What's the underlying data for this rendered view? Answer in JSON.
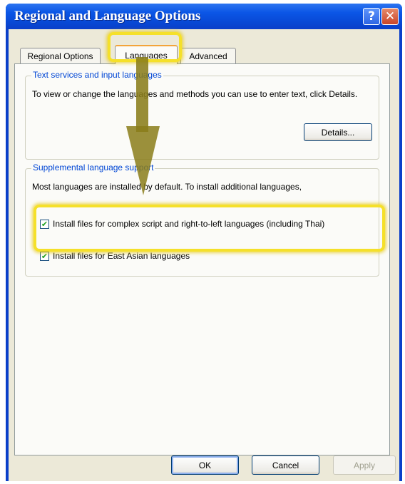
{
  "window": {
    "title": "Regional and Language Options"
  },
  "titlebar_buttons": {
    "help": "?",
    "close": "✕"
  },
  "tabs": [
    {
      "label": "Regional Options"
    },
    {
      "label": "Languages"
    },
    {
      "label": "Advanced"
    }
  ],
  "text_services": {
    "legend": "Text services and input languages",
    "description": "To view or change the languages and methods you can use to enter text, click Details.",
    "details_button": "Details..."
  },
  "supplemental": {
    "legend": "Supplemental language support",
    "description": "Most languages are installed by default. To install additional languages,",
    "checkboxes": [
      {
        "label": "Install files for complex script and right-to-left languages (including Thai)",
        "checked": true
      },
      {
        "label": "Install files for East Asian languages",
        "checked": true
      }
    ]
  },
  "footer": {
    "ok": "OK",
    "cancel": "Cancel",
    "apply": "Apply"
  },
  "colors": {
    "title_blue": "#0a3fc9",
    "legend_blue": "#0046d5",
    "highlight_yellow": "#f5e02a",
    "arrow_olive": "#8a7d1a"
  },
  "icons": {
    "check": "✔"
  }
}
